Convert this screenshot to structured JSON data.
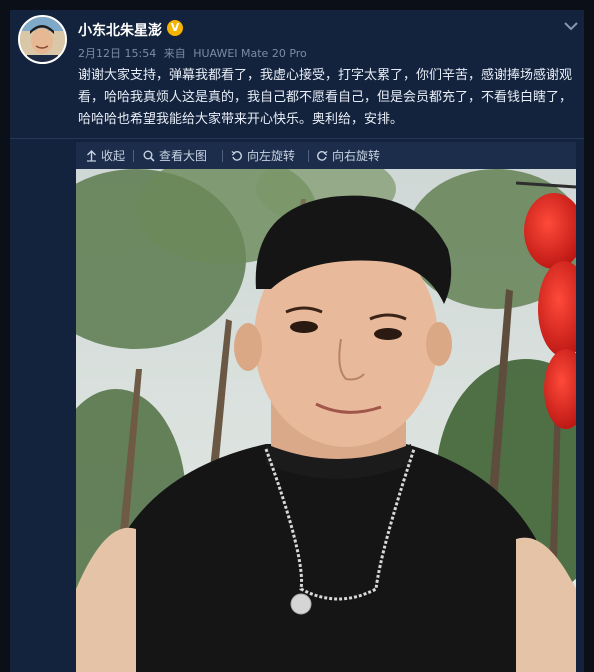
{
  "post": {
    "username": "小东北朱星澎",
    "verified_badge": "V",
    "date": "2月12日 15:54",
    "source_prefix": "来自",
    "source_device": "HUAWEI Mate 20 Pro",
    "content": "谢谢大家支持，弹幕我都看了，我虚心接受，打字太累了，你们辛苦，感谢捧场感谢观看，哈哈我真烦人这是真的，我自己都不愿看自己，但是会员都充了，不看钱白瞎了，哈哈哈也希望我能给大家带来开心快乐。奥利给，安排。"
  },
  "actions": [
    {
      "label": "收起",
      "icon": "collapse-arrow-icon"
    },
    {
      "label": "查看大图",
      "icon": "magnify-icon"
    },
    {
      "label": "向左旋转",
      "icon": "rotate-left-icon"
    },
    {
      "label": "向右旋转",
      "icon": "rotate-right-icon"
    }
  ],
  "icons": {
    "expand": "chevron-down-icon",
    "avatar": "avatar-photo",
    "photo": "selfie-photo"
  },
  "colors": {
    "background": "#13233d",
    "badge": "#f6b300",
    "meta_text": "#7b8ba6"
  }
}
